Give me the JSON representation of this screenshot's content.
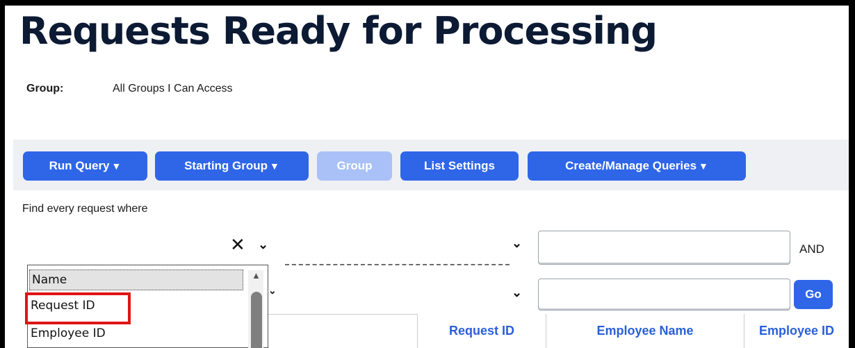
{
  "page": {
    "title": "Requests Ready for Processing",
    "group_label": "Group:",
    "group_value": "All Groups I Can Access"
  },
  "toolbar": {
    "run_query": "Run Query",
    "starting_group": "Starting Group",
    "group": "Group",
    "list_settings": "List Settings",
    "create_manage": "Create/Manage Queries"
  },
  "filter": {
    "intro": "Find every request where",
    "and_label": "AND",
    "go_label": "Go",
    "dropdown_options": [
      "Name",
      "Request ID",
      "Employee ID"
    ],
    "selected_option": "Name",
    "highlighted_option": "Request ID"
  },
  "table": {
    "columns": [
      "Request ID",
      "Employee Name",
      "Employee ID"
    ]
  },
  "colors": {
    "accent": "#2f66e8",
    "accent_disabled": "#a9c1f6",
    "title": "#0c1a33",
    "highlight": "#e01515"
  },
  "icons": [
    "clear-x-icon",
    "chevron-down-icon",
    "caret-down-icon",
    "scroll-up-arrow-icon"
  ]
}
